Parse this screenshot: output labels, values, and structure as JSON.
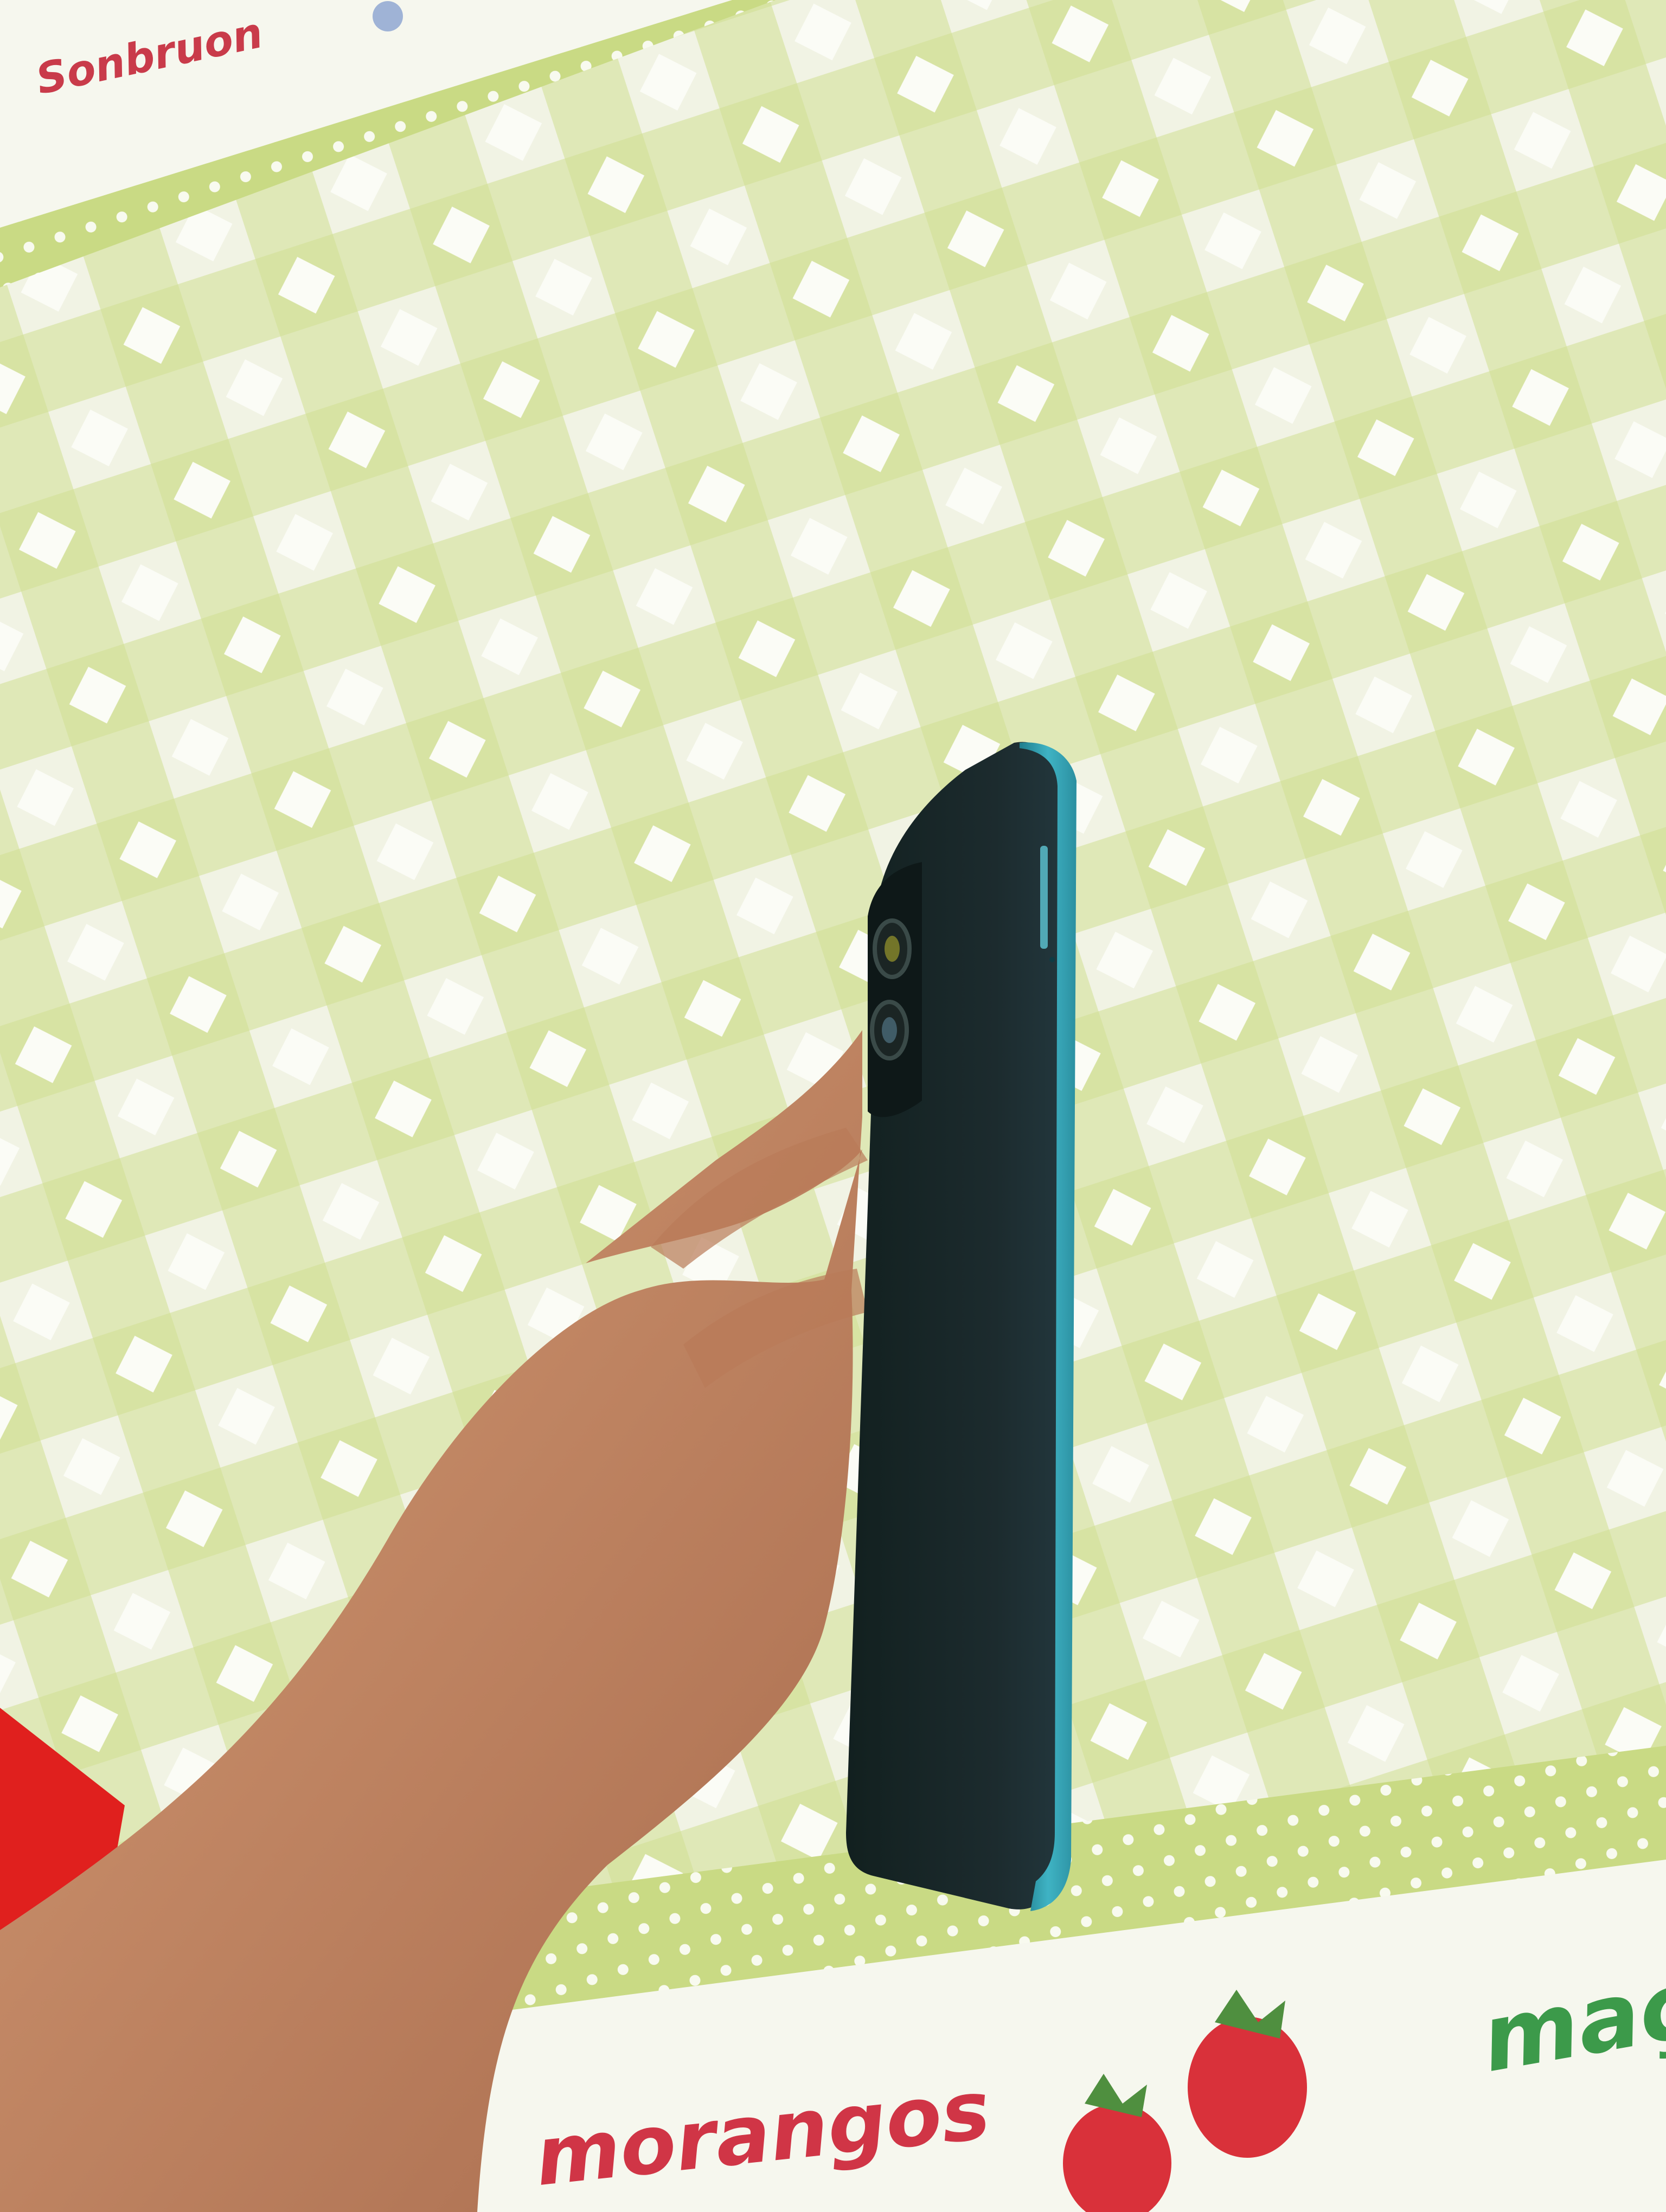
{
  "scene": {
    "colors": {
      "cloth_base": "#f1f3e4",
      "check_green": "#cddc8c",
      "check_green_dark": "#b9cd6e",
      "white_diamond": "#fbfcf6",
      "phone_body": "#1c2a2f",
      "phone_edge": "#2e9fb0",
      "skin": "#c8906c",
      "skin_shadow": "#9b6548",
      "red_object": "#e0201e",
      "strawberry": "#d9313a",
      "leaf": "#4f8f3f"
    }
  },
  "print_text": {
    "top_left": "Sonbruon",
    "bottom_left": "morangos",
    "bottom_right": "maçã",
    "top_left_color": "#c93b4a",
    "bottom_left_color": "#d03546",
    "bottom_right_color": "#3c9a4a"
  }
}
